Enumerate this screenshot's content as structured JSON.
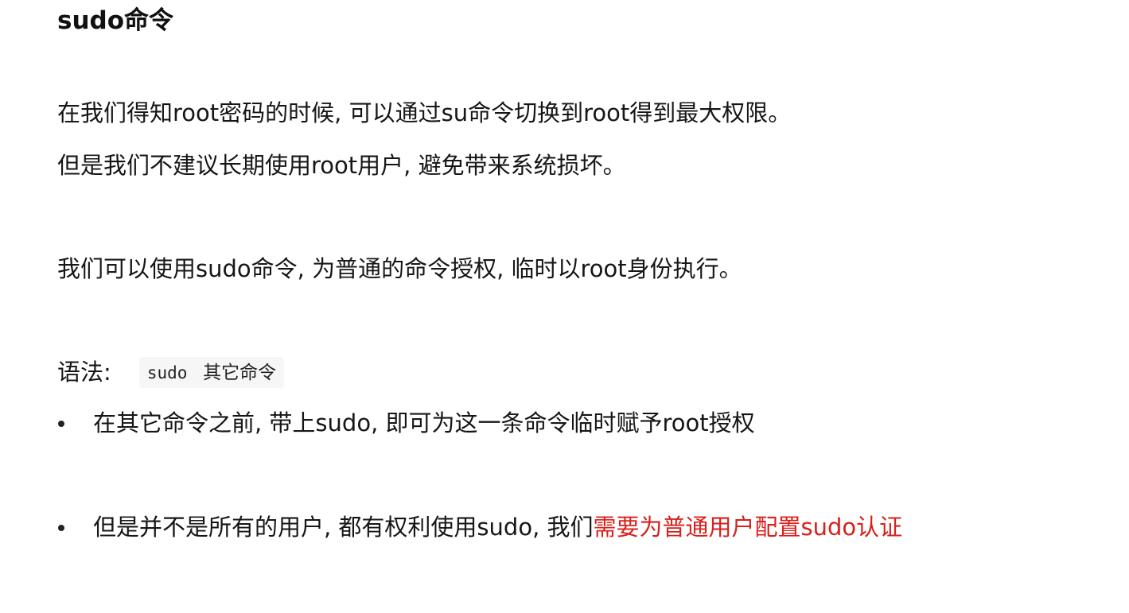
{
  "title": "sudo命令",
  "paragraphs": {
    "p1": "在我们得知root密码的时候, 可以通过su命令切换到root得到最大权限。",
    "p2": "但是我们不建议长期使用root用户, 避免带来系统损坏。",
    "p3": "我们可以使用sudo命令, 为普通的命令授权, 临时以root身份执行。"
  },
  "syntax": {
    "label": "语法:",
    "code_command": "sudo",
    "code_arg": "其它命令"
  },
  "bullets": [
    {
      "text": "在其它命令之前, 带上sudo, 即可为这一条命令临时赋予root授权",
      "highlight": ""
    },
    {
      "text": "但是并不是所有的用户, 都有权利使用sudo, 我们",
      "highlight": "需要为普通用户配置sudo认证"
    }
  ],
  "colors": {
    "text": "#161616",
    "highlight": "#d9201c",
    "code_background": "#f6f6f6"
  }
}
